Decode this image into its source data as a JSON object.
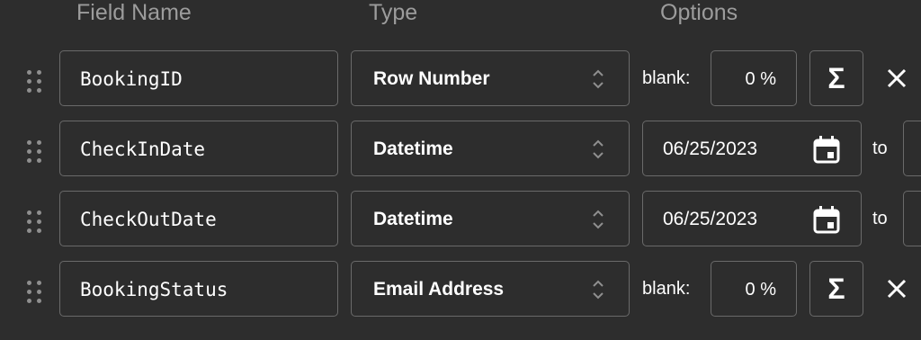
{
  "headers": {
    "field_name": "Field Name",
    "type": "Type",
    "options": "Options"
  },
  "rows": [
    {
      "field_name": "BookingID",
      "type": "Row Number",
      "options": {
        "blank_label": "blank:",
        "blank_value": "0 %",
        "sigma": "Σ"
      }
    },
    {
      "field_name": "CheckInDate",
      "type": "Datetime",
      "options": {
        "from_date": "06/25/2023",
        "to_label": "to"
      }
    },
    {
      "field_name": "CheckOutDate",
      "type": "Datetime",
      "options": {
        "from_date": "06/25/2023",
        "to_label": "to"
      }
    },
    {
      "field_name": "BookingStatus",
      "type": "Email Address",
      "options": {
        "blank_label": "blank:",
        "blank_value": "0 %",
        "sigma": "Σ"
      }
    }
  ],
  "icons": {
    "drag": "drag-handle-icon",
    "sort": "sort-arrows-icon",
    "calendar": "calendar-icon",
    "close": "close-icon",
    "formula": "sigma-icon"
  },
  "colors": {
    "background": "#2d2d2d",
    "border": "#6a6a6a",
    "header_text": "#9c9c9c",
    "text": "#ffffff",
    "icon": "#8f8f8f"
  }
}
